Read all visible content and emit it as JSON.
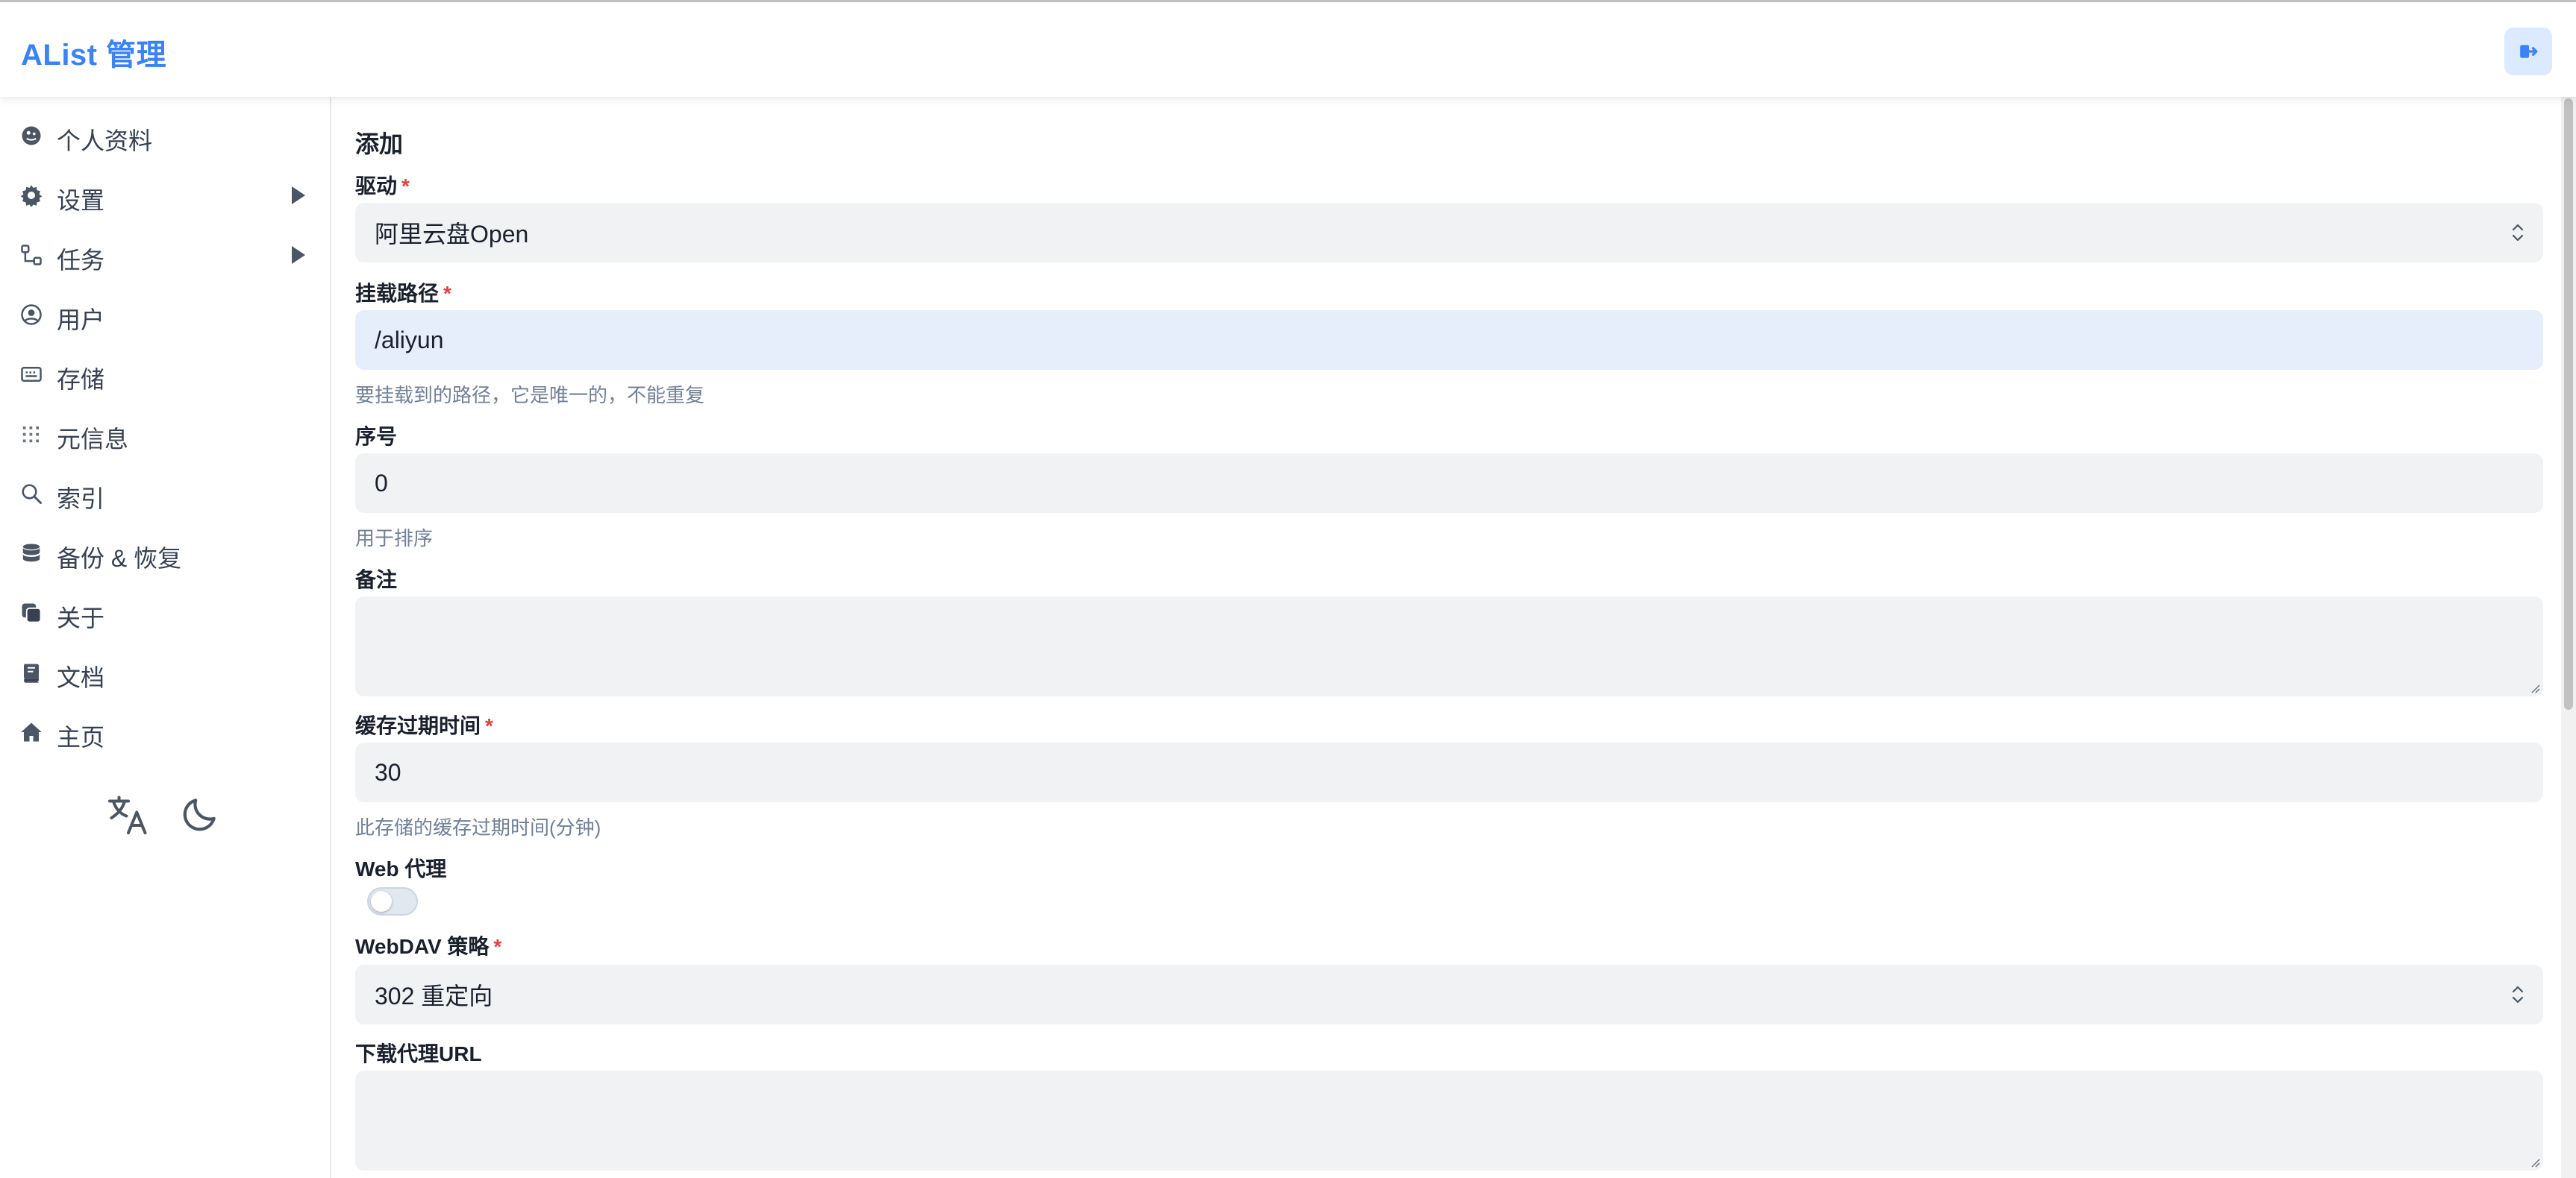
{
  "app": {
    "title": "AList 管理"
  },
  "sidebar": {
    "items": [
      {
        "label": "个人资料",
        "icon": "user-profile-icon",
        "has_arrow": false
      },
      {
        "label": "设置",
        "icon": "gear-icon",
        "has_arrow": true
      },
      {
        "label": "任务",
        "icon": "tasks-icon",
        "has_arrow": true
      },
      {
        "label": "用户",
        "icon": "user-circle-icon",
        "has_arrow": false
      },
      {
        "label": "存储",
        "icon": "storage-icon",
        "has_arrow": false
      },
      {
        "label": "元信息",
        "icon": "meta-icon",
        "has_arrow": false
      },
      {
        "label": "索引",
        "icon": "search-icon",
        "has_arrow": false
      },
      {
        "label": "备份 & 恢复",
        "icon": "database-icon",
        "has_arrow": false
      },
      {
        "label": "关于",
        "icon": "about-icon",
        "has_arrow": false
      },
      {
        "label": "文档",
        "icon": "book-icon",
        "has_arrow": false
      },
      {
        "label": "主页",
        "icon": "home-icon",
        "has_arrow": false
      }
    ],
    "tools": {
      "language_icon": "translate-icon",
      "theme_icon": "moon-icon"
    }
  },
  "form": {
    "section_title": "添加",
    "required_mark": "*",
    "driver": {
      "label": "驱动",
      "value": "阿里云盘Open"
    },
    "mount_path": {
      "label": "挂载路径",
      "value": "/aliyun",
      "helper": "要挂载到的路径，它是唯一的，不能重复"
    },
    "order": {
      "label": "序号",
      "value": "0",
      "helper": "用于排序"
    },
    "remark": {
      "label": "备注",
      "value": ""
    },
    "cache_expiration": {
      "label": "缓存过期时间",
      "value": "30",
      "helper": "此存储的缓存过期时间(分钟)"
    },
    "web_proxy": {
      "label": "Web 代理",
      "enabled": false
    },
    "webdav_policy": {
      "label": "WebDAV 策略",
      "value": "302 重定向"
    },
    "download_proxy_url": {
      "label": "下载代理URL",
      "value": ""
    }
  },
  "colors": {
    "brand": "#3b82f6",
    "required": "#e53e3e",
    "field_bg": "#f1f2f4",
    "focus_bg": "#e6eefc"
  }
}
